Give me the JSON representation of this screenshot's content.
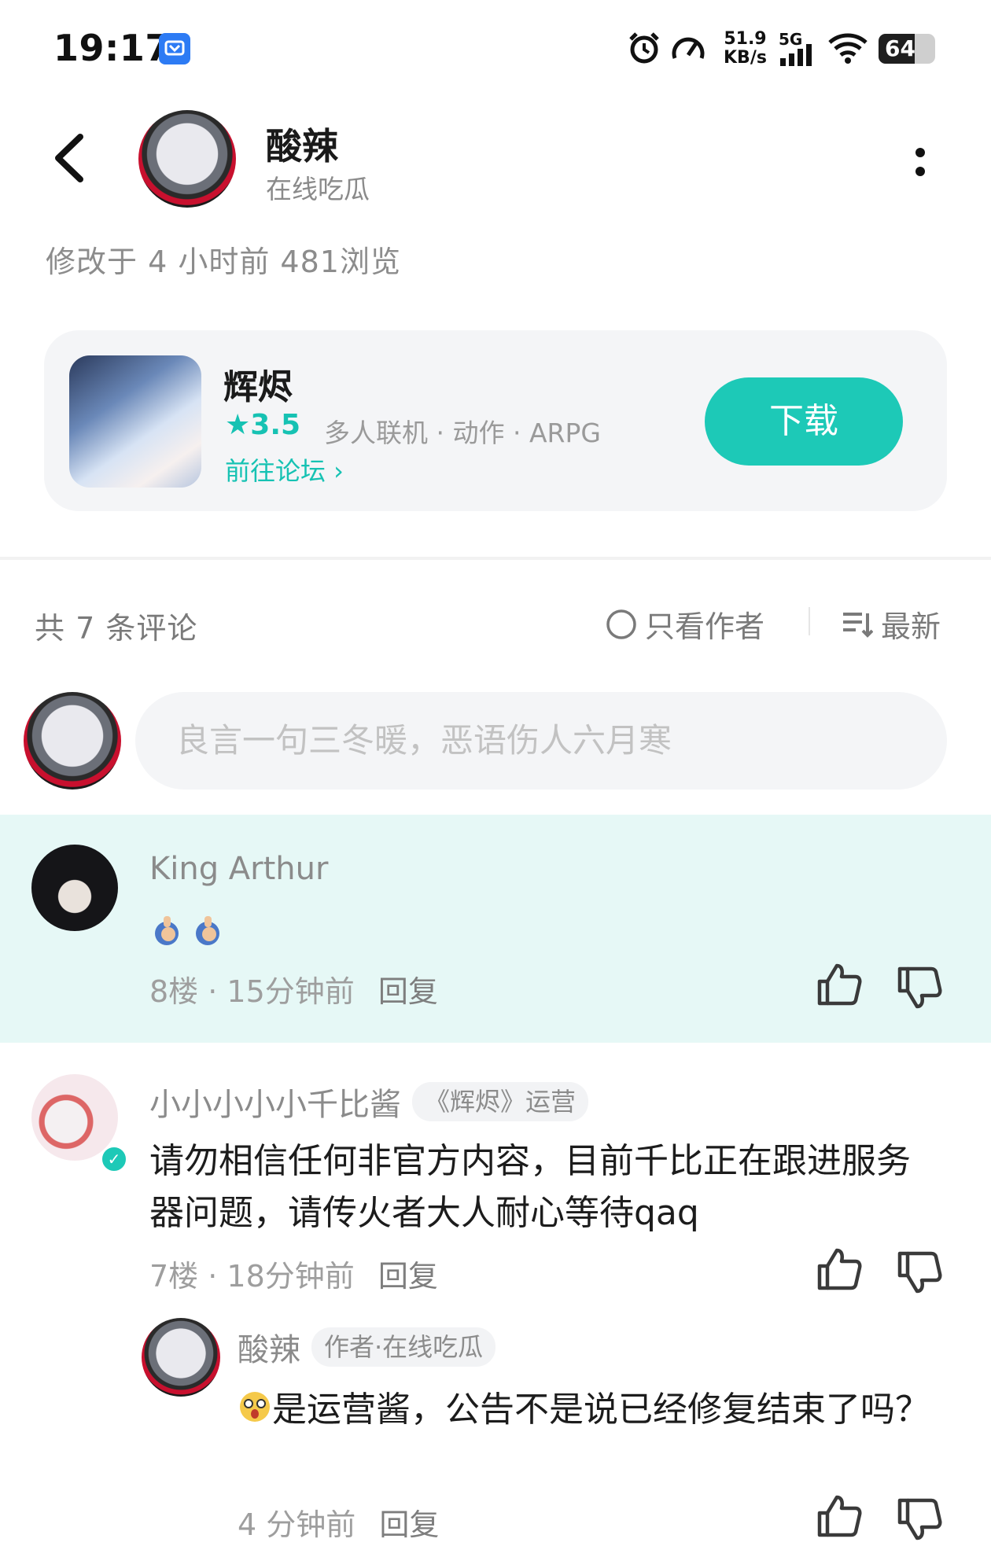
{
  "status_bar": {
    "time": "19:17",
    "speed_value": "51.9",
    "speed_unit": "KB/s",
    "network": "5G",
    "battery": "64"
  },
  "header": {
    "title": "酸辣",
    "subtitle": "在线吃瓜",
    "meta": "修改于 4 小时前   481浏览"
  },
  "app_card": {
    "name": "辉烬",
    "rating": "★3.5",
    "tags": "多人联机 · 动作 · ARPG",
    "forum_link": "前往论坛 ›",
    "download_label": "下载"
  },
  "comments_header": {
    "count": "共 7 条评论",
    "only_author": "只看作者",
    "sort": "最新"
  },
  "comment_input": {
    "placeholder": "良言一句三冬暖，恶语伤人六月寒"
  },
  "comments": [
    {
      "author": "King Arthur",
      "floor_time": "8楼 · 15分钟前",
      "reply_label": "回复"
    },
    {
      "author": "小小小小小千比酱",
      "badge": "《辉烬》运营",
      "text": "请勿相信任何非官方内容，目前千比正在跟进服务器问题，请传火者大人耐心等待qaq",
      "floor_time": "7楼 · 18分钟前",
      "reply_label": "回复"
    }
  ],
  "reply": {
    "author": "酸辣",
    "badge": "作者·在线吃瓜",
    "text": "是运营酱，公告不是说已经修复结束了吗？",
    "time": "4 分钟前",
    "reply_label": "回复"
  },
  "colors": {
    "accent": "#1dc9b7",
    "highlight_bg": "#e6f8f6",
    "card_bg": "#f4f5f7"
  }
}
